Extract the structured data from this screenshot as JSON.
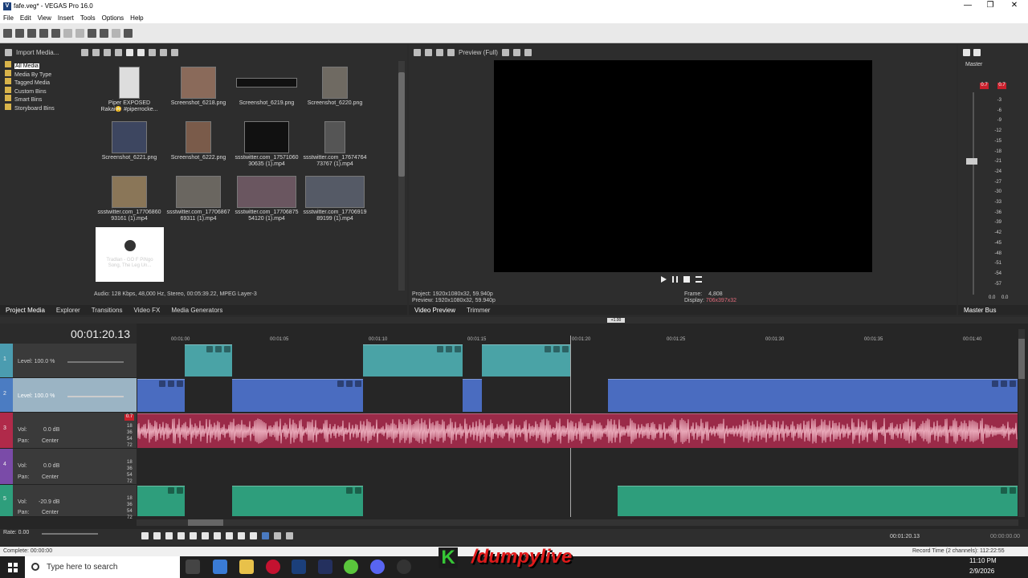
{
  "window": {
    "title": "fafe.veg* - VEGAS Pro 16.0",
    "app_icon": "V"
  },
  "menu": [
    "File",
    "Edit",
    "View",
    "Insert",
    "Tools",
    "Options",
    "Help"
  ],
  "media_pane": {
    "import_label": "Import Media...",
    "tree": [
      "All Media",
      "Media By Type",
      "Tagged Media",
      "Custom Bins",
      "Smart Bins",
      "Storyboard Bins"
    ],
    "thumbs": [
      {
        "l1": "Piper EXPOSED",
        "l2": "Rakai😳 #piperrocke..."
      },
      {
        "l1": "Screenshot_6218.png",
        "l2": ""
      },
      {
        "l1": "Screenshot_6219.png",
        "l2": ""
      },
      {
        "l1": "Screenshot_6220.png",
        "l2": ""
      },
      {
        "l1": "Screenshot_6221.png",
        "l2": ""
      },
      {
        "l1": "Screenshot_6222.png",
        "l2": ""
      },
      {
        "l1": "ssstwitter.com_17571060",
        "l2": "30635 (1).mp4"
      },
      {
        "l1": "ssstwitter.com_17674764",
        "l2": "73767 (1).mp4"
      },
      {
        "l1": "ssstwitter.com_17706860",
        "l2": "93161 (1).mp4"
      },
      {
        "l1": "ssstwitter.com_17706867",
        "l2": "69311 (1).mp4"
      },
      {
        "l1": "ssstwitter.com_17706875",
        "l2": "54120 (1).mp4"
      },
      {
        "l1": "ssstwitter.com_17706919",
        "l2": "89199 (1).mp4"
      },
      {
        "l1": "Tradlan - GO F PiNgo",
        "l2": "Song, The Leg Un..."
      }
    ],
    "info": "Audio: 128 Kbps, 48,000 Hz, Stereo, 00:05:39.22, MPEG Layer-3",
    "tabs": [
      "Project Media",
      "Explorer",
      "Transitions",
      "Video FX",
      "Media Generators"
    ]
  },
  "preview": {
    "quality": "Preview (Full)",
    "project_label": "Project:",
    "project_val": "1920x1080x32, 59.940p",
    "preview_label": "Preview:",
    "preview_val": "1920x1080x32, 59.940p",
    "frame_label": "Frame:",
    "frame_val": "4,808",
    "display_label": "Display:",
    "display_val": "706x397x32",
    "tabs": [
      "Video Preview",
      "Trimmer"
    ]
  },
  "master": {
    "title": "Master",
    "peak_l": "0.7",
    "peak_r": "0.7",
    "ticks": [
      "3",
      "6",
      "9",
      "12",
      "15",
      "18",
      "21",
      "24",
      "27",
      "30",
      "33",
      "36",
      "39",
      "42",
      "45",
      "48",
      "51",
      "54",
      "57"
    ],
    "bottom_l": "0.0",
    "bottom_r": "0.0",
    "tab": "Master Bus"
  },
  "timeline": {
    "timecode": "00:01:20.13",
    "cursor_badge": "+1.00",
    "ruler": [
      "00:01:00",
      "00:01:05",
      "00:01:10",
      "00:01:15",
      "00:01:20",
      "00:01:25",
      "00:01:30",
      "00:01:35",
      "00:01:40"
    ],
    "tracks": [
      {
        "num": "1",
        "level_label": "Level: 100.0 %"
      },
      {
        "num": "2",
        "level_label": "Level: 100.0 %"
      },
      {
        "num": "3",
        "vol_label": "Vol:",
        "vol": "0.0 dB",
        "pan_label": "Pan:",
        "pan": "Center",
        "peak": "0.7"
      },
      {
        "num": "4",
        "vol_label": "Vol:",
        "vol": "0.0 dB",
        "pan_label": "Pan:",
        "pan": "Center"
      },
      {
        "num": "5",
        "vol_label": "Vol:",
        "vol": "-20.9 dB",
        "pan_label": "Pan:",
        "pan": "Center"
      }
    ],
    "db_ticks": [
      "18",
      "36",
      "54",
      "72"
    ],
    "rate": "Rate: 0.00",
    "cursor_time": "00:01:20.13",
    "end_time": "00:00:00.00"
  },
  "status": {
    "left": "Complete: 00:00:00",
    "right": "Record Time (2 channels): 112:22:55"
  },
  "taskbar": {
    "search": "Type here to search",
    "time": "11:10 PM",
    "date": "2/9/2026"
  },
  "overlay": {
    "text": "/dumpylive",
    "k": "K"
  }
}
